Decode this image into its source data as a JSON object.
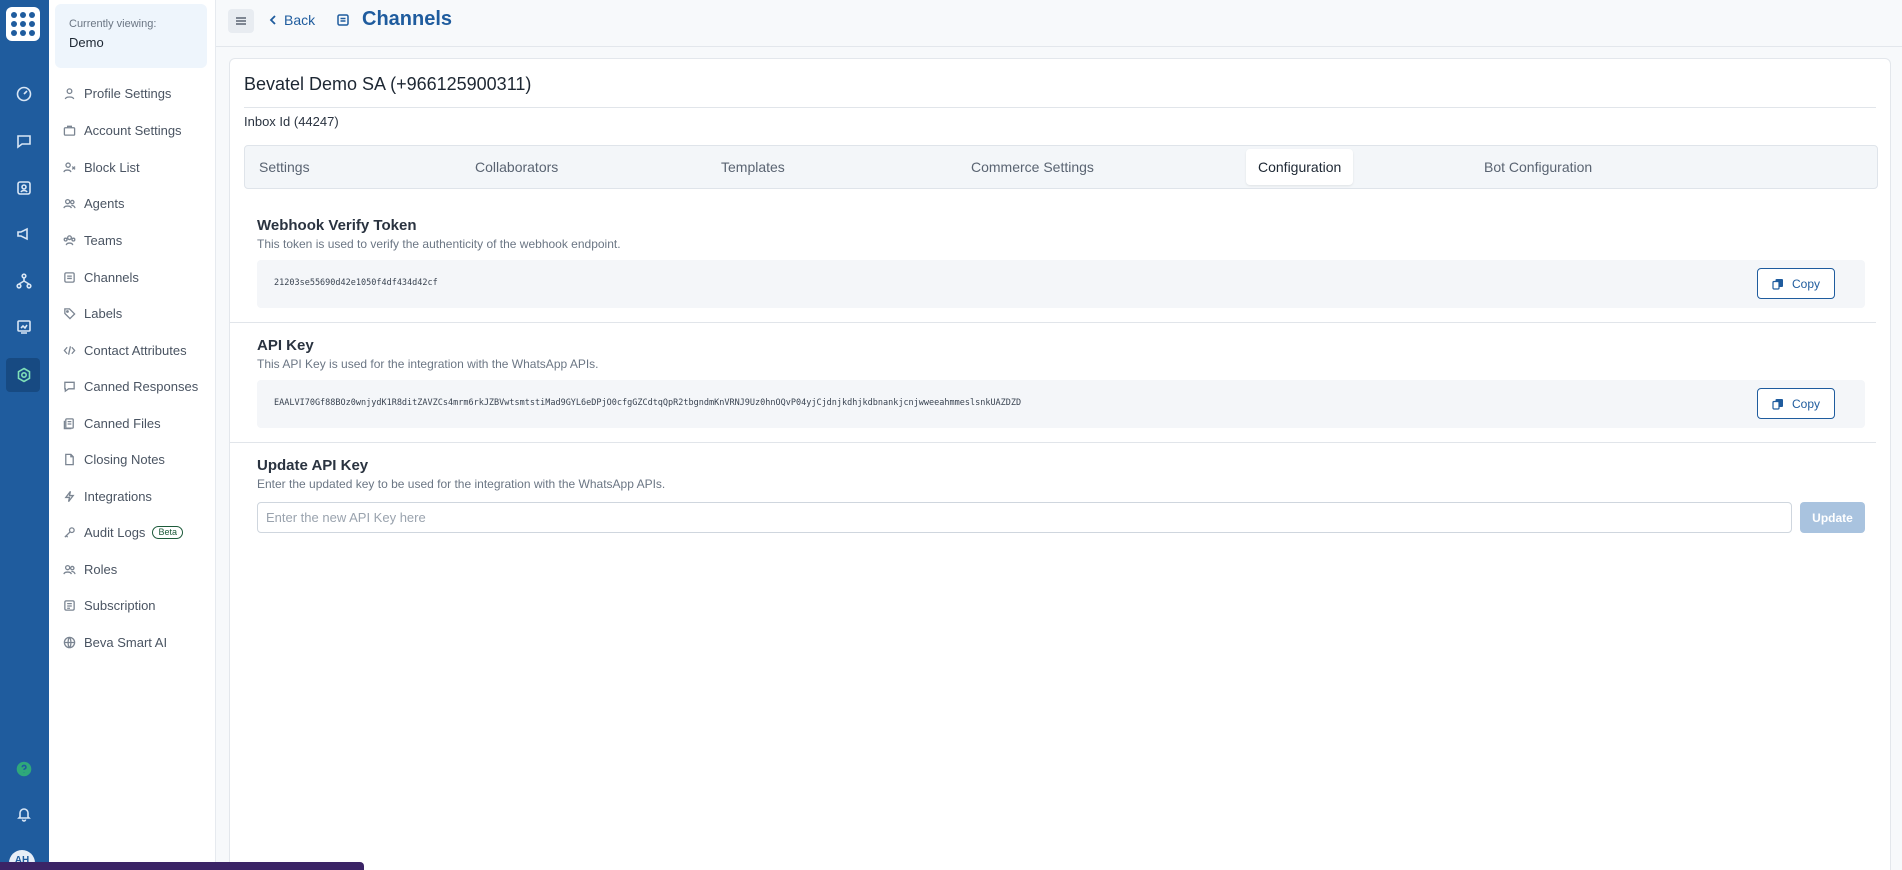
{
  "rail": {
    "avatar_initials": "AH",
    "icons": [
      "dashboard-icon",
      "conversations-icon",
      "contacts-icon",
      "campaigns-icon",
      "flows-icon",
      "reports-icon",
      "settings-icon",
      "help-icon",
      "bell-icon"
    ]
  },
  "sidebar": {
    "viewing_label": "Currently viewing:",
    "viewing_value": "Demo",
    "items": [
      {
        "label": "Profile Settings",
        "icon": "user-icon"
      },
      {
        "label": "Account Settings",
        "icon": "briefcase-icon"
      },
      {
        "label": "Block List",
        "icon": "block-user-icon"
      },
      {
        "label": "Agents",
        "icon": "agents-icon"
      },
      {
        "label": "Teams",
        "icon": "teams-icon"
      },
      {
        "label": "Channels",
        "icon": "channel-icon"
      },
      {
        "label": "Labels",
        "icon": "tag-icon"
      },
      {
        "label": "Contact Attributes",
        "icon": "code-icon"
      },
      {
        "label": "Canned Responses",
        "icon": "chat-icon"
      },
      {
        "label": "Canned Files",
        "icon": "files-icon"
      },
      {
        "label": "Closing Notes",
        "icon": "note-icon"
      },
      {
        "label": "Integrations",
        "icon": "bolt-icon"
      },
      {
        "label": "Audit Logs",
        "icon": "key-icon",
        "badge": "Beta"
      },
      {
        "label": "Roles",
        "icon": "roles-icon"
      },
      {
        "label": "Subscription",
        "icon": "subscription-icon"
      },
      {
        "label": "Beva Smart AI",
        "icon": "ai-icon"
      }
    ]
  },
  "header": {
    "back_label": "Back",
    "title": "Channels"
  },
  "inbox": {
    "title": "Bevatel Demo SA (+966125900311)",
    "id_label": "Inbox Id (44247)"
  },
  "tabs": [
    {
      "label": "Settings",
      "active": false
    },
    {
      "label": "Collaborators",
      "active": false
    },
    {
      "label": "Templates",
      "active": false
    },
    {
      "label": "Commerce Settings",
      "active": false
    },
    {
      "label": "Configuration",
      "active": true
    },
    {
      "label": "Bot Configuration",
      "active": false
    }
  ],
  "webhook": {
    "title": "Webhook Verify Token",
    "description": "This token is used to verify the authenticity of the webhook endpoint.",
    "value": "21203se55690d42e1050f4df434d42cf",
    "copy_label": "Copy"
  },
  "api_key": {
    "title": "API Key",
    "description": "This API Key is used for the integration with the WhatsApp APIs.",
    "value": "EAALVI70Gf88BOz0wnjydK1R8ditZAVZCs4mrm6rkJZBVwtsmtstiMad9GYL6eDPjO0cfgGZCdtqQpR2tbgndmKnVRNJ9Uz0hnOQvP04yjCjdnjkdhjkdbnankjcnjwweeahmmeslsnkUAZDZD",
    "copy_label": "Copy"
  },
  "update_key": {
    "title": "Update API Key",
    "description": "Enter the updated key to be used for the integration with the WhatsApp APIs.",
    "placeholder": "Enter the new API Key here",
    "button_label": "Update"
  }
}
